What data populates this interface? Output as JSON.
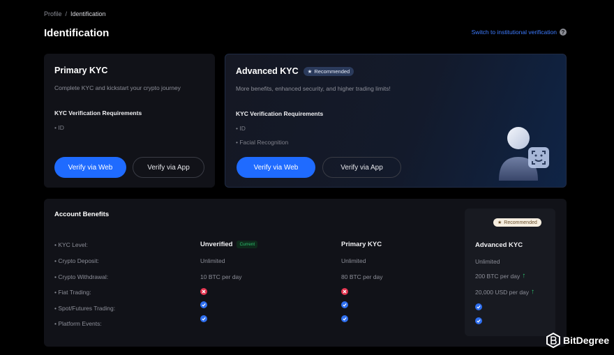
{
  "breadcrumb": {
    "parent": "Profile",
    "separator": "/",
    "current": "Identification"
  },
  "page": {
    "title": "Identification",
    "switch_link": "Switch to institutional verification"
  },
  "primary_card": {
    "title": "Primary KYC",
    "subtitle": "Complete KYC and kickstart your crypto journey",
    "req_title": "KYC Verification Requirements",
    "requirements": [
      "• ID"
    ],
    "btn_web": "Verify via Web",
    "btn_app": "Verify via App"
  },
  "advanced_card": {
    "title": "Advanced KYC",
    "badge": "Recommended",
    "subtitle": "More benefits, enhanced security, and higher trading limits!",
    "req_title": "KYC Verification Requirements",
    "requirements": [
      "• ID",
      "• Facial Recognition"
    ],
    "btn_web": "Verify via Web",
    "btn_app": "Verify via App"
  },
  "benefits": {
    "title": "Account Benefits",
    "rows": [
      "• KYC Level:",
      "• Crypto Deposit:",
      "• Crypto Withdrawal:",
      "• Fiat Trading:",
      "• Spot/Futures Trading:",
      "• Platform Events:"
    ],
    "unverified": {
      "header": "Unverified",
      "current_badge": "Current",
      "deposit": "Unlimited",
      "withdrawal": "10 BTC per day",
      "fiat": "cross-icon",
      "spot": "check-icon",
      "events": "check-icon"
    },
    "primary": {
      "header": "Primary KYC",
      "deposit": "Unlimited",
      "withdrawal": "80 BTC per day",
      "fiat": "cross-icon",
      "spot": "check-icon",
      "events": "check-icon"
    },
    "advanced": {
      "badge": "Recommended",
      "header": "Advanced KYC",
      "deposit": "Unlimited",
      "withdrawal": "200 BTC per day",
      "fiat": "20,000 USD per day",
      "spot": "check-icon",
      "events": "check-icon"
    }
  },
  "watermark": {
    "text": "BitDegree"
  },
  "colors": {
    "accent": "#1f6bff",
    "success": "#2ec16f",
    "danger": "#e2344f",
    "background": "#000000",
    "card": "#111218"
  }
}
